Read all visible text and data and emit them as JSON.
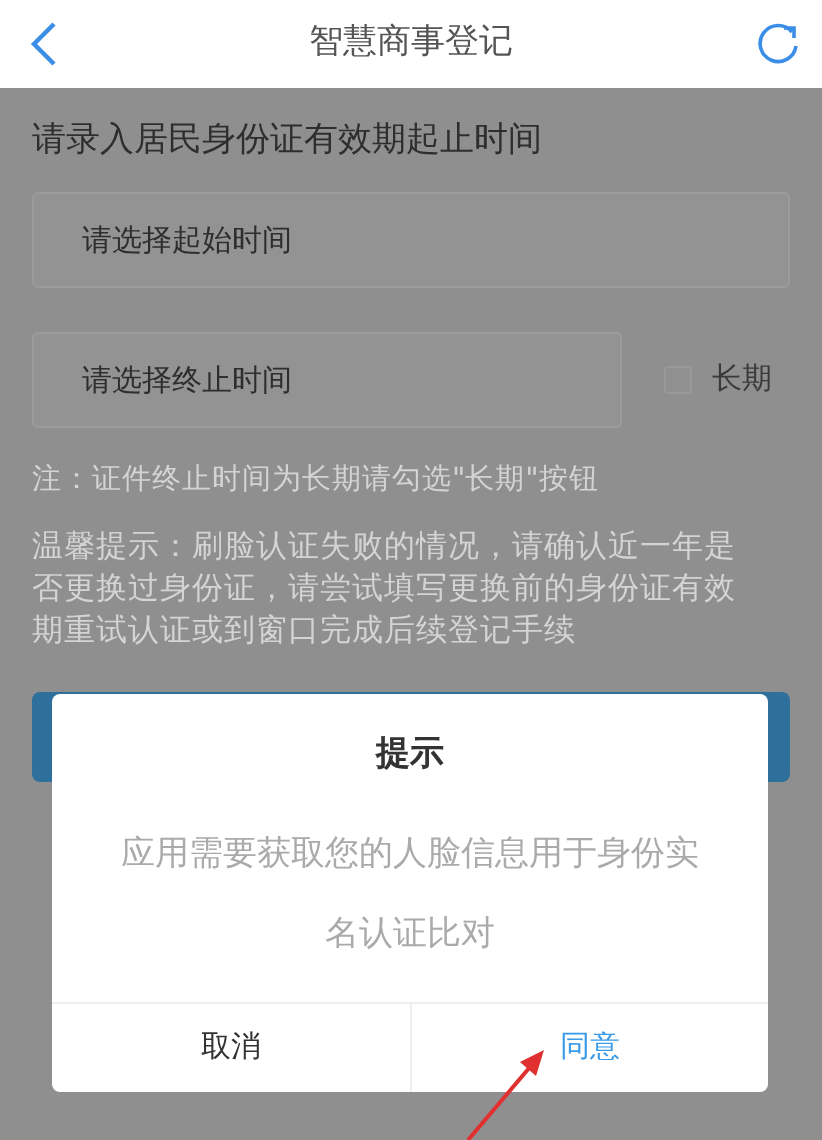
{
  "header": {
    "title": "智慧商事登记"
  },
  "form": {
    "heading": "请录入居民身份证有效期起止时间",
    "start_field": {
      "placeholder": "请选择起始时间"
    },
    "end_field": {
      "placeholder": "请选择终止时间"
    },
    "long_term": {
      "label": "长期",
      "checked": false
    },
    "note": "注：证件终止时间为长期请勾选\"长期\"按钮",
    "tip": "温馨提示：刷脸认证失败的情况，请确认近一年是否更换过身份证，请尝试填写更换前的身份证有效期重试认证或到窗口完成后续登记手续"
  },
  "dialog": {
    "title": "提示",
    "message": "应用需要获取您的人脸信息用于身份实名认证比对",
    "buttons": [
      {
        "label": "取消",
        "kind": "cancel"
      },
      {
        "label": "同意",
        "kind": "confirm"
      }
    ]
  }
}
